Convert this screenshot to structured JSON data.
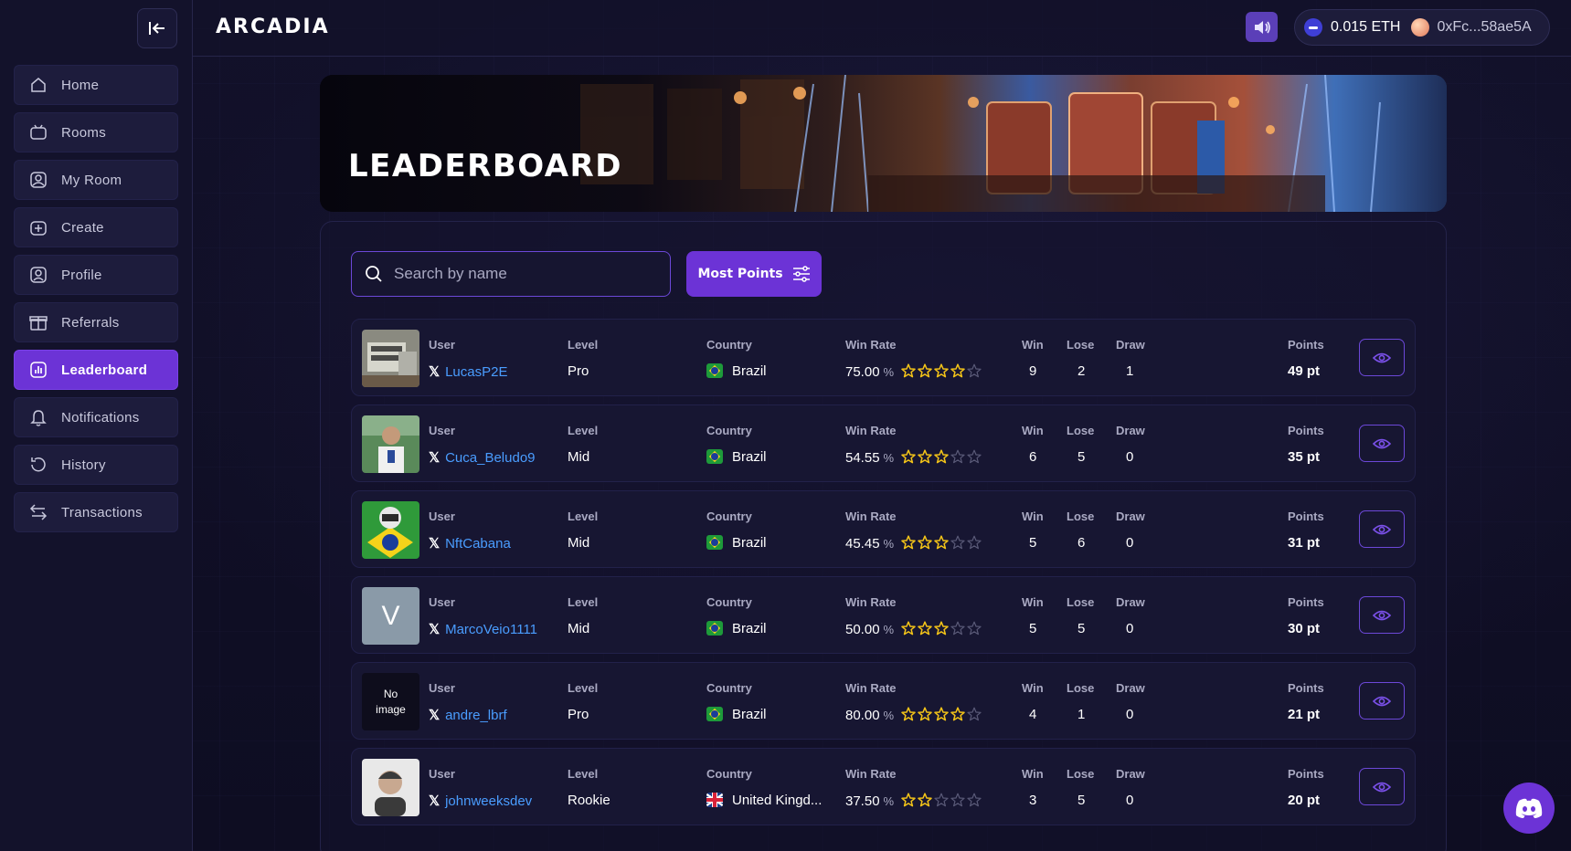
{
  "app": {
    "title": "ARCADIA"
  },
  "colors": {
    "accent": "#6c33d6",
    "link": "#4a9dff",
    "star": "#f5c518"
  },
  "sidebar": {
    "items": [
      {
        "label": "Home",
        "icon": "home-icon",
        "active": false
      },
      {
        "label": "Rooms",
        "icon": "rooms-icon",
        "active": false
      },
      {
        "label": "My Room",
        "icon": "my-room-icon",
        "active": false
      },
      {
        "label": "Create",
        "icon": "create-icon",
        "active": false
      },
      {
        "label": "Profile",
        "icon": "profile-icon",
        "active": false
      },
      {
        "label": "Referrals",
        "icon": "gift-icon",
        "active": false
      },
      {
        "label": "Leaderboard",
        "icon": "chart-icon",
        "active": true
      },
      {
        "label": "Notifications",
        "icon": "bell-icon",
        "active": false
      },
      {
        "label": "History",
        "icon": "history-icon",
        "active": false
      },
      {
        "label": "Transactions",
        "icon": "transfer-icon",
        "active": false
      }
    ]
  },
  "header": {
    "balance": "0.015 ETH",
    "address": "0xFc...58ae5A"
  },
  "banner": {
    "title": "LEADERBOARD"
  },
  "filters": {
    "search_placeholder": "Search by name",
    "sort_label": "Most Points"
  },
  "columns": {
    "user": "User",
    "level": "Level",
    "country": "Country",
    "win_rate": "Win Rate",
    "win": "Win",
    "lose": "Lose",
    "draw": "Draw",
    "points": "Points"
  },
  "rows": [
    {
      "avatar": "photo",
      "user": "LucasP2E",
      "level": "Pro",
      "country": "Brazil",
      "flag": "br",
      "win_rate": "75.00",
      "stars": 4,
      "win": "9",
      "lose": "2",
      "draw": "1",
      "points": "49 pt"
    },
    {
      "avatar": "photo",
      "user": "Cuca_Beludo9",
      "level": "Mid",
      "country": "Brazil",
      "flag": "br",
      "win_rate": "54.55",
      "stars": 3,
      "win": "6",
      "lose": "5",
      "draw": "0",
      "points": "35 pt"
    },
    {
      "avatar": "photo",
      "user": "NftCabana",
      "level": "Mid",
      "country": "Brazil",
      "flag": "br",
      "win_rate": "45.45",
      "stars": 3,
      "win": "5",
      "lose": "6",
      "draw": "0",
      "points": "31 pt"
    },
    {
      "avatar": "initial",
      "initial": "V",
      "user": "MarcoVeio1111",
      "level": "Mid",
      "country": "Brazil",
      "flag": "br",
      "win_rate": "50.00",
      "stars": 3,
      "win": "5",
      "lose": "5",
      "draw": "0",
      "points": "30 pt"
    },
    {
      "avatar": "none",
      "no_image": "No image",
      "user": "andre_lbrf",
      "level": "Pro",
      "country": "Brazil",
      "flag": "br",
      "win_rate": "80.00",
      "stars": 4,
      "win": "4",
      "lose": "1",
      "draw": "0",
      "points": "21 pt"
    },
    {
      "avatar": "photo",
      "user": "johnweeksdev",
      "level": "Rookie",
      "country": "United Kingd...",
      "flag": "uk",
      "win_rate": "37.50",
      "stars": 2,
      "win": "3",
      "lose": "5",
      "draw": "0",
      "points": "20 pt"
    }
  ],
  "units": {
    "percent": "%"
  }
}
